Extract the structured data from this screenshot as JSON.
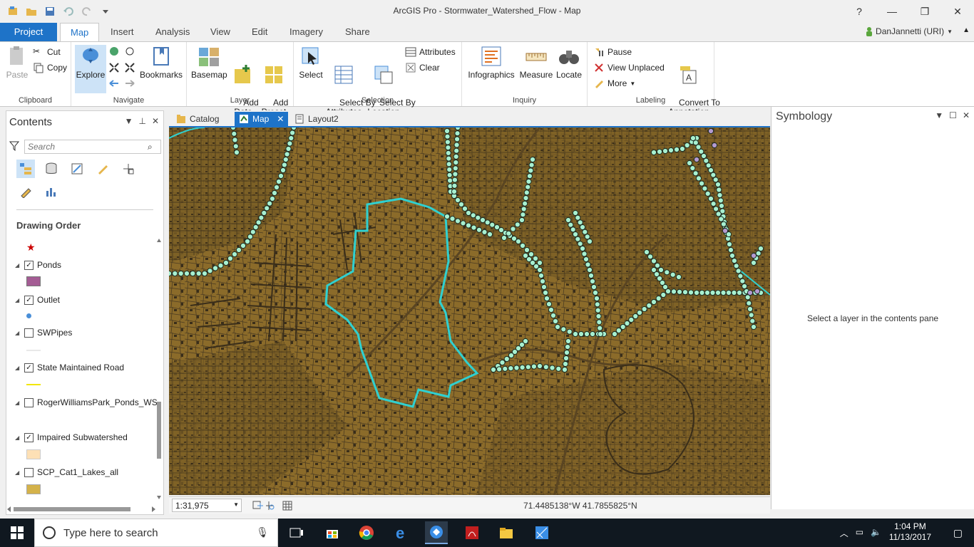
{
  "titlebar": {
    "title": "ArcGIS Pro - Stormwater_Watershed_Flow - Map",
    "help": "?",
    "minimize": "—",
    "maximize": "❐",
    "close": "✕"
  },
  "tabs": {
    "project": "Project",
    "items": [
      "Map",
      "Insert",
      "Analysis",
      "View",
      "Edit",
      "Imagery",
      "Share"
    ],
    "user": "DanJannetti (URI)"
  },
  "ribbon": {
    "clipboard": {
      "label": "Clipboard",
      "paste": "Paste",
      "cut": "Cut",
      "copy": "Copy"
    },
    "navigate": {
      "label": "Navigate",
      "explore": "Explore",
      "bookmarks": "Bookmarks"
    },
    "layer": {
      "label": "Layer",
      "basemap": "Basemap",
      "add_data": "Add\nData",
      "add_preset": "Add\nPreset"
    },
    "selection": {
      "label": "Selection",
      "select": "Select",
      "select_by_attributes": "Select By\nAttributes",
      "select_by_location": "Select By\nLocation",
      "attributes": "Attributes",
      "clear": "Clear"
    },
    "inquiry": {
      "label": "Inquiry",
      "infographics": "Infographics",
      "measure": "Measure",
      "locate": "Locate"
    },
    "labeling": {
      "label": "Labeling",
      "pause": "Pause",
      "view_unplaced": "View Unplaced",
      "more": "More",
      "convert": "Convert To\nAnnotation"
    }
  },
  "contents": {
    "title": "Contents",
    "search_placeholder": "Search",
    "drawing_order": "Drawing Order",
    "layers": [
      {
        "name": "Ponds",
        "checked": true,
        "swatch": "#a45c94"
      },
      {
        "name": "Outlet",
        "checked": true,
        "swatch": "#4a8fd8"
      },
      {
        "name": "SWPipes",
        "checked": false,
        "swatch": "#e8e8e8"
      },
      {
        "name": "State Maintained Road",
        "checked": true,
        "swatch": "#f2e600"
      },
      {
        "name": "RogerWilliamsPark_Ponds_WS",
        "checked": false,
        "swatch": ""
      },
      {
        "name": "Impaired Subwatershed",
        "checked": true,
        "swatch": "#fde0b5"
      },
      {
        "name": "SCP_Cat1_Lakes_all",
        "checked": false,
        "swatch": "#d4b24a"
      }
    ]
  },
  "views": {
    "tabs": [
      "Catalog",
      "Map",
      "Layout2"
    ],
    "active": "Map"
  },
  "map": {
    "scale": "1:31,975",
    "coordinates": "71.4485138°W 41.7855825°N",
    "background_color": "#8b6b2a",
    "watershed_color": "#2fd0d0",
    "point_color": "#a8f0d0"
  },
  "symbology": {
    "title": "Symbology",
    "message": "Select a layer in the contents pane"
  },
  "taskbar": {
    "search": "Type here to search",
    "time": "1:04 PM",
    "date": "11/13/2017"
  }
}
